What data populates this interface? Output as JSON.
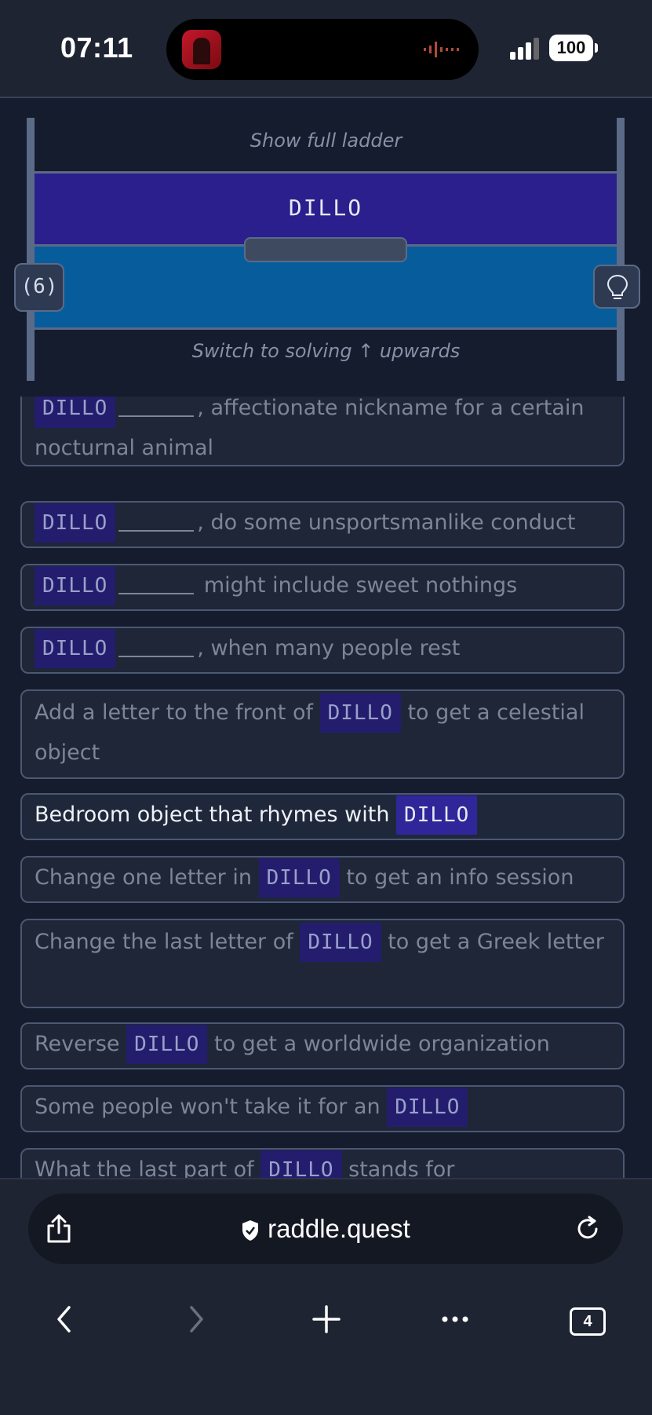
{
  "status_bar": {
    "time": "07:11",
    "battery": "100"
  },
  "ladder": {
    "show_full": "Show full ladder",
    "current_word": "DILLO",
    "remaining_count": "(6)",
    "switch_direction": "Switch to solving ↑ upwards"
  },
  "clues": [
    {
      "pre": "",
      "word": "DILLO",
      "blank": true,
      "post": ", affectionate nickname for a certain nocturnal animal",
      "active": false
    },
    {
      "pre": "",
      "word": "DILLO",
      "blank": true,
      "post": ", do some unsportsmanlike conduct",
      "active": false
    },
    {
      "pre": "",
      "word": "DILLO",
      "blank": true,
      "post": " might include sweet nothings",
      "active": false
    },
    {
      "pre": "",
      "word": "DILLO",
      "blank": true,
      "post": ", when many people rest",
      "active": false
    },
    {
      "pre": "Add a letter to the front of ",
      "word": "DILLO",
      "blank": false,
      "post": " to get a celestial object",
      "active": false
    },
    {
      "pre": "Bedroom object that rhymes with ",
      "word": "DILLO",
      "blank": false,
      "post": "",
      "active": true
    },
    {
      "pre": "Change one letter in ",
      "word": "DILLO",
      "blank": false,
      "post": " to get an info session",
      "active": false
    },
    {
      "pre": "Change the last letter of ",
      "word": "DILLO",
      "blank": false,
      "post": " to get a Greek letter",
      "active": false
    },
    {
      "pre": "Reverse ",
      "word": "DILLO",
      "blank": false,
      "post": " to get a worldwide organization",
      "active": false
    },
    {
      "pre": "Some people won't take it for an ",
      "word": "DILLO",
      "blank": false,
      "post": "",
      "active": false
    },
    {
      "pre": "What the last part of ",
      "word": "DILLO",
      "blank": false,
      "post": " stands for",
      "active": false
    }
  ],
  "browser": {
    "url": "raddle.quest",
    "tab_count": "4"
  }
}
